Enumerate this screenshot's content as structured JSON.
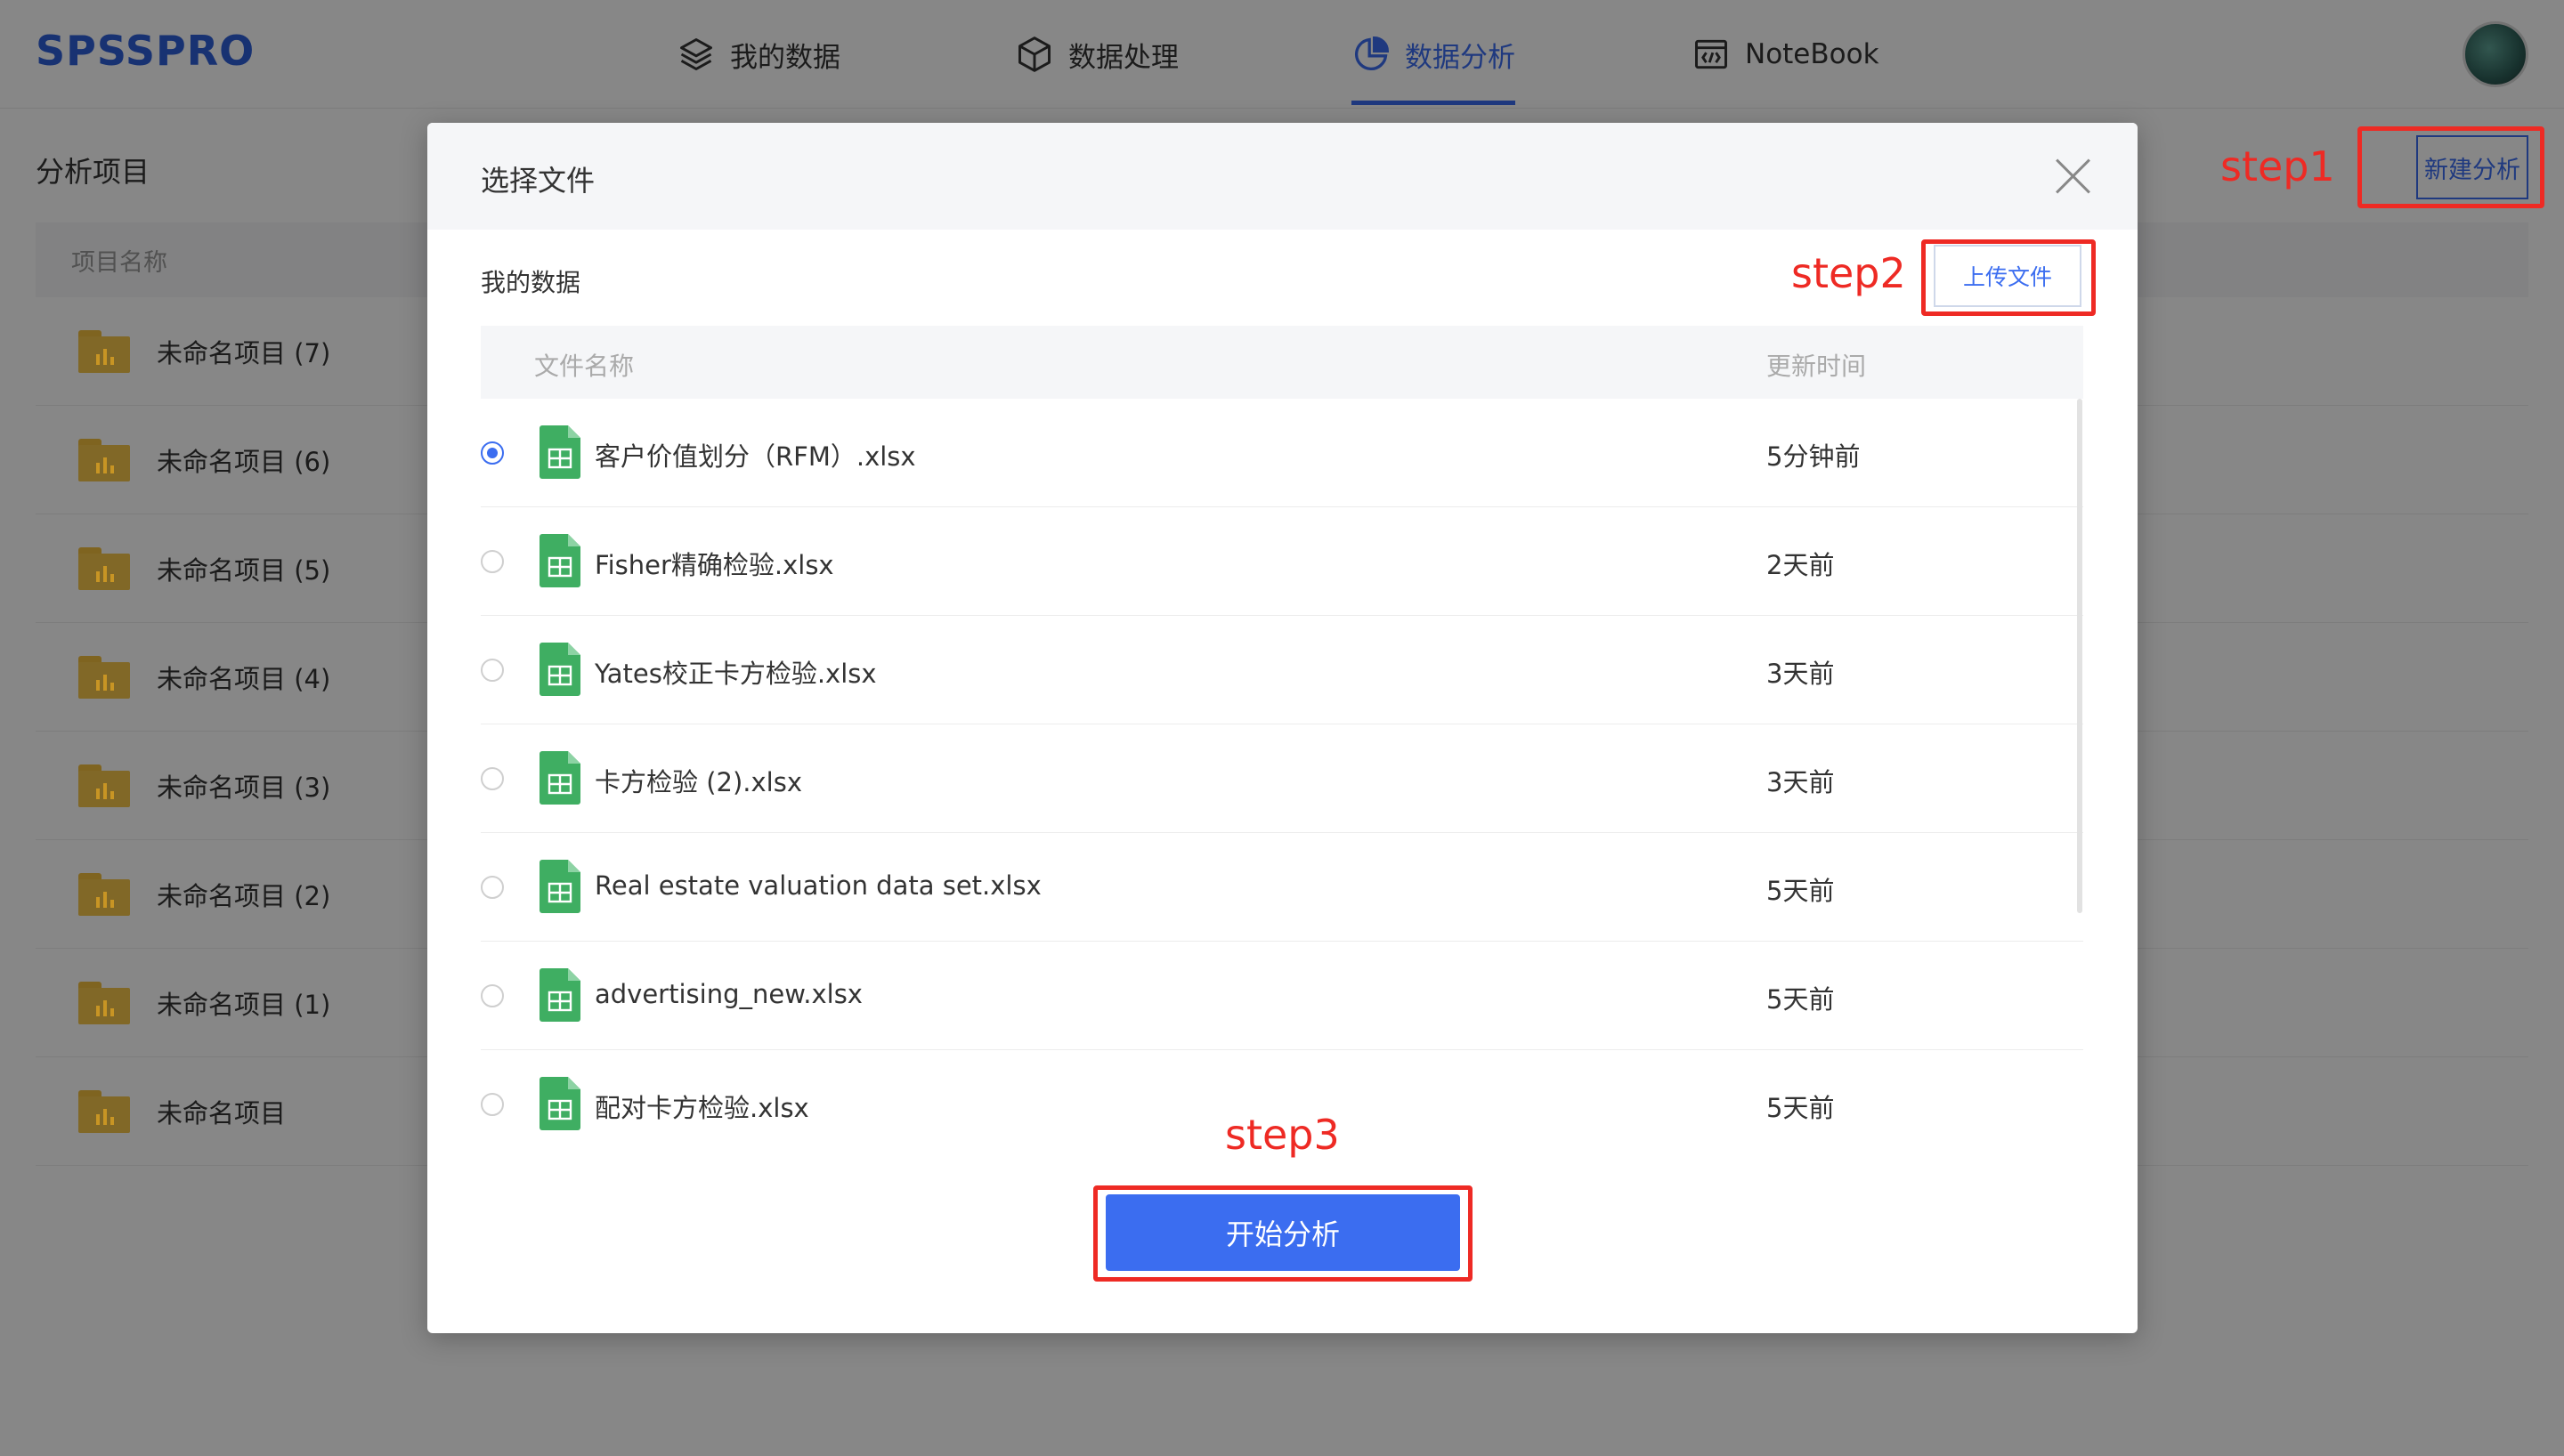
{
  "app": {
    "logo": "SPSSPRO",
    "nav": [
      {
        "label": "我的数据",
        "icon": "layers-icon"
      },
      {
        "label": "数据处理",
        "icon": "cube-icon"
      },
      {
        "label": "数据分析",
        "icon": "pie-chart-icon",
        "active": true
      },
      {
        "label": "NoteBook",
        "icon": "code-window-icon"
      }
    ]
  },
  "page": {
    "title": "分析项目",
    "new_analysis_button": "新建分析",
    "table_header": "项目名称",
    "projects": [
      "未命名项目 (7)",
      "未命名项目 (6)",
      "未命名项目 (5)",
      "未命名项目 (4)",
      "未命名项目 (3)",
      "未命名项目 (2)",
      "未命名项目 (1)",
      "未命名项目"
    ]
  },
  "annotations": {
    "step1": "step1",
    "step2": "step2",
    "step3": "step3",
    "color": "#ee2a24"
  },
  "modal": {
    "title": "选择文件",
    "section_label": "我的数据",
    "upload_button": "上传文件",
    "columns": {
      "name": "文件名称",
      "updated": "更新时间"
    },
    "files": [
      {
        "name": "客户价值划分（RFM）.xlsx",
        "updated": "5分钟前",
        "selected": true
      },
      {
        "name": "Fisher精确检验.xlsx",
        "updated": "2天前",
        "selected": false
      },
      {
        "name": "Yates校正卡方检验.xlsx",
        "updated": "3天前",
        "selected": false
      },
      {
        "name": "卡方检验 (2).xlsx",
        "updated": "3天前",
        "selected": false
      },
      {
        "name": "Real estate valuation data set.xlsx",
        "updated": "5天前",
        "selected": false
      },
      {
        "name": "advertising_new.xlsx",
        "updated": "5天前",
        "selected": false
      },
      {
        "name": "配对卡方检验.xlsx",
        "updated": "5天前",
        "selected": false
      }
    ],
    "start_button": "开始分析"
  },
  "colors": {
    "primary": "#3b6df0",
    "excel_green": "#3fae62",
    "folder": "#f3c54a"
  }
}
